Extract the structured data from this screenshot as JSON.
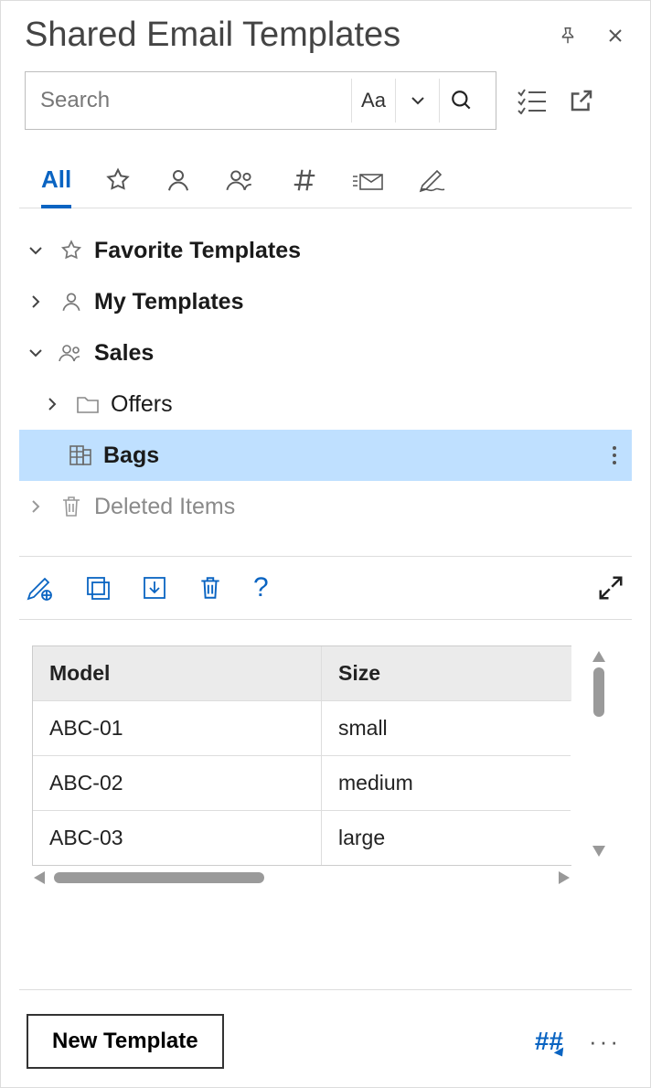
{
  "header": {
    "title": "Shared Email Templates"
  },
  "search": {
    "placeholder": "Search",
    "case_button": "Aa"
  },
  "tabs": {
    "all_label": "All"
  },
  "tree": {
    "favorite_label": "Favorite Templates",
    "my_templates_label": "My Templates",
    "sales_label": "Sales",
    "offers_label": "Offers",
    "bags_label": "Bags",
    "deleted_label": "Deleted Items"
  },
  "toolbar": {
    "help_label": "?"
  },
  "table": {
    "columns": {
      "model": "Model",
      "size": "Size"
    },
    "rows": [
      {
        "model": "ABC-01",
        "size": "small"
      },
      {
        "model": "ABC-02",
        "size": "medium"
      },
      {
        "model": "ABC-03",
        "size": "large"
      }
    ]
  },
  "footer": {
    "new_template": "New Template",
    "hashtag": "##",
    "more": "···"
  }
}
